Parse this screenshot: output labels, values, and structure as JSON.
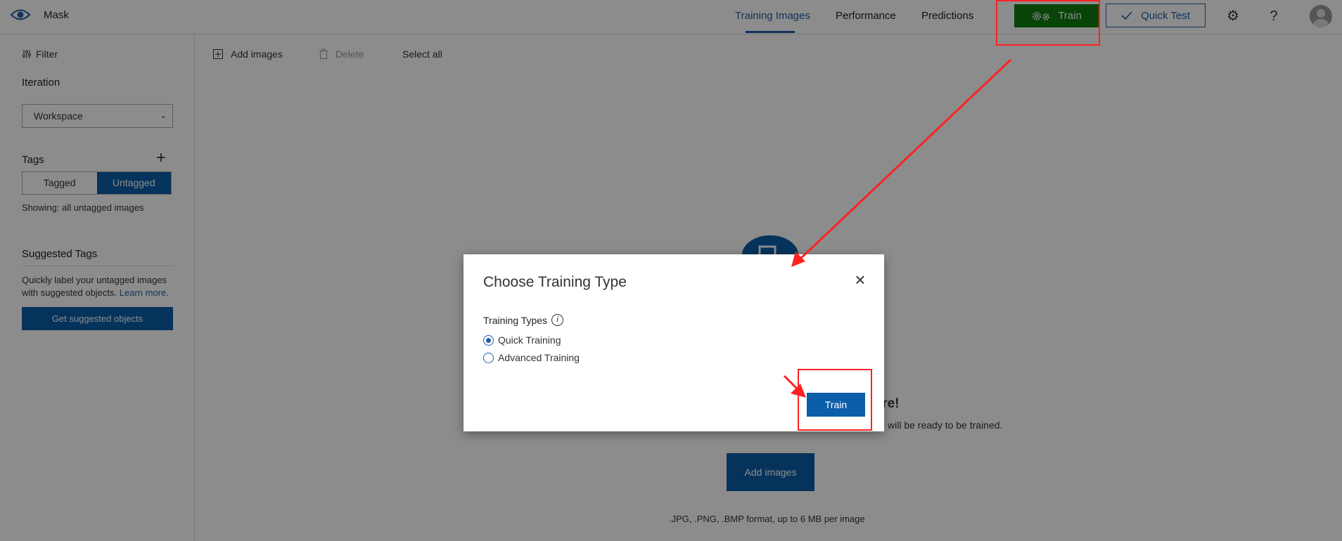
{
  "header": {
    "app_name": "Mask",
    "tabs": [
      {
        "label": "Training Images",
        "active": true
      },
      {
        "label": "Performance",
        "active": false
      },
      {
        "label": "Predictions",
        "active": false
      }
    ],
    "train_label": "Train",
    "quick_test_label": "Quick Test"
  },
  "sidebar": {
    "filter_label": "Filter",
    "iteration_heading": "Iteration",
    "iteration_value": "Workspace",
    "tags_heading": "Tags",
    "tagged_label": "Tagged",
    "untagged_label": "Untagged",
    "showing_text": "Showing: all untagged images",
    "suggested_heading": "Suggested Tags",
    "suggested_desc": "Quickly label your untagged images with suggested objects.",
    "learn_more": "Learn more.",
    "get_suggested_label": "Get suggested objects"
  },
  "toolbar": {
    "add_images": "Add images",
    "delete": "Delete",
    "select_all": "Select all"
  },
  "empty_state": {
    "title_visible": "here!",
    "subtitle_visible": "will be ready to be trained.",
    "add_images_button": "Add images",
    "formats": ".JPG, .PNG, .BMP format, up to 6 MB per image"
  },
  "modal": {
    "title": "Choose Training Type",
    "types_label": "Training Types",
    "options": [
      {
        "label": "Quick Training",
        "selected": true
      },
      {
        "label": "Advanced Training",
        "selected": false
      }
    ],
    "train_button": "Train"
  },
  "colors": {
    "accent": "#0b5ea8",
    "train_green": "#107c10",
    "annotation_red": "#ff2222"
  }
}
